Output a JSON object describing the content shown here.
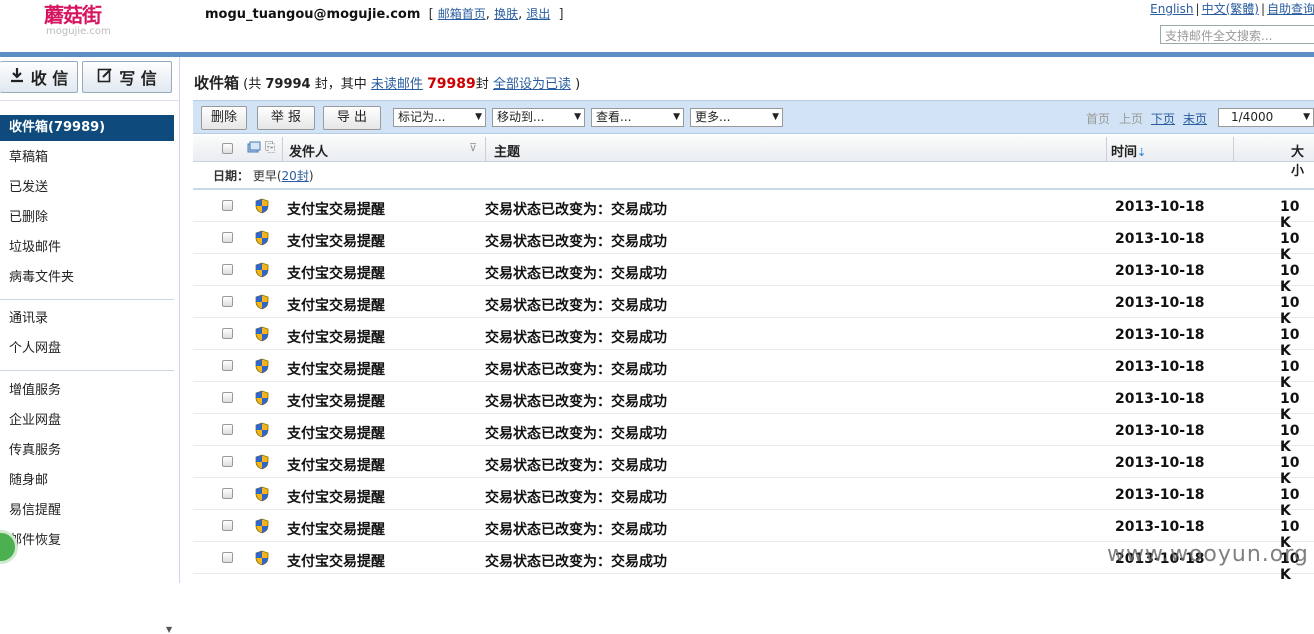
{
  "header": {
    "logo_cn": "蘑菇街",
    "logo_en": "mogujie.com",
    "user_email": "mogu_tuangou@mogujie.com",
    "links": [
      "邮箱首页",
      "换肤",
      "退出"
    ],
    "lang_links": [
      "English",
      "中文(繁體)",
      "自助查询"
    ],
    "search_placeholder": "支持邮件全文搜索..."
  },
  "sidebar": {
    "receive_label": "收 信",
    "write_label": "写 信",
    "folders": [
      {
        "label": "收件箱(79989)",
        "active": true
      },
      {
        "label": "草稿箱"
      },
      {
        "label": "已发送"
      },
      {
        "label": "已删除"
      },
      {
        "label": "垃圾邮件"
      },
      {
        "label": "病毒文件夹"
      }
    ],
    "tools": [
      "通讯录",
      "个人网盘"
    ],
    "services": [
      "增值服务",
      "企业网盘",
      "传真服务",
      "随身邮",
      "易信提醒",
      "邮件恢复"
    ]
  },
  "inbox": {
    "title": "收件箱",
    "total_prefix": "(共",
    "total": "79994",
    "total_suffix": "封，其中",
    "unread_link": "未读邮件",
    "unread_count": "79989",
    "unread_suffix": "封",
    "mark_all_read": "全部设为已读",
    "close_paren": ")"
  },
  "toolbar": {
    "delete": "删除",
    "report": "举 报",
    "export": "导 出",
    "mark_as": "标记为...",
    "move_to": "移动到...",
    "view": "查看...",
    "more": "更多...",
    "first": "首页",
    "prev": "上页",
    "next": "下页",
    "last": "末页",
    "page": "1/4000"
  },
  "columns": {
    "sender": "发件人",
    "subject": "主题",
    "time": "时间",
    "size": "大小"
  },
  "group": {
    "label": "日期：",
    "name": "更早",
    "count_open": "(",
    "count_link": "20封",
    "count_close": ")"
  },
  "emails": [
    {
      "sender": "支付宝交易提醒",
      "subject": "交易状态已改变为：交易成功",
      "date": "2013-10-18",
      "size": "10 K"
    },
    {
      "sender": "支付宝交易提醒",
      "subject": "交易状态已改变为：交易成功",
      "date": "2013-10-18",
      "size": "10 K"
    },
    {
      "sender": "支付宝交易提醒",
      "subject": "交易状态已改变为：交易成功",
      "date": "2013-10-18",
      "size": "10 K"
    },
    {
      "sender": "支付宝交易提醒",
      "subject": "交易状态已改变为：交易成功",
      "date": "2013-10-18",
      "size": "10 K"
    },
    {
      "sender": "支付宝交易提醒",
      "subject": "交易状态已改变为：交易成功",
      "date": "2013-10-18",
      "size": "10 K"
    },
    {
      "sender": "支付宝交易提醒",
      "subject": "交易状态已改变为：交易成功",
      "date": "2013-10-18",
      "size": "10 K"
    },
    {
      "sender": "支付宝交易提醒",
      "subject": "交易状态已改变为：交易成功",
      "date": "2013-10-18",
      "size": "10 K"
    },
    {
      "sender": "支付宝交易提醒",
      "subject": "交易状态已改变为：交易成功",
      "date": "2013-10-18",
      "size": "10 K"
    },
    {
      "sender": "支付宝交易提醒",
      "subject": "交易状态已改变为：交易成功",
      "date": "2013-10-18",
      "size": "10 K"
    },
    {
      "sender": "支付宝交易提醒",
      "subject": "交易状态已改变为：交易成功",
      "date": "2013-10-18",
      "size": "10 K"
    },
    {
      "sender": "支付宝交易提醒",
      "subject": "交易状态已改变为：交易成功",
      "date": "2013-10-18",
      "size": "10 K"
    },
    {
      "sender": "支付宝交易提醒",
      "subject": "交易状态已改变为：交易成功",
      "date": "2013-10-18",
      "size": "10 K"
    }
  ],
  "watermark": "www.wooyun.org",
  "colors": {
    "accent": "#0e4a7c",
    "toolbar_bg": "#d1e3f4",
    "unread_red": "#cc0000",
    "logo": "#d6145f"
  }
}
